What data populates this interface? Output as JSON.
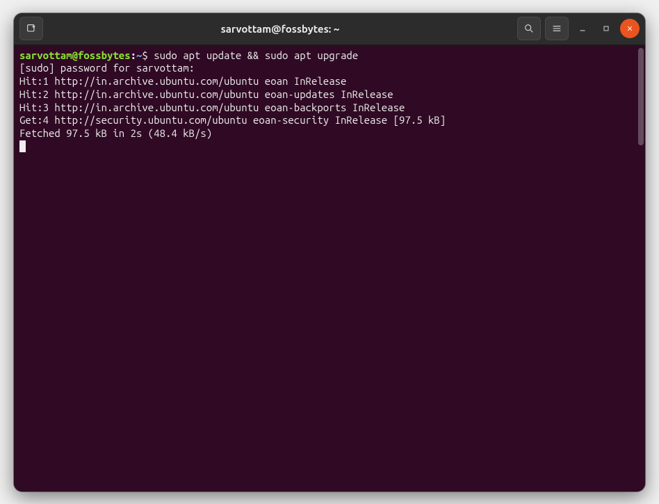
{
  "titlebar": {
    "title": "sarvottam@fossbytes: ~",
    "icons": {
      "new_tab": "new-tab-icon",
      "search": "search-icon",
      "menu": "menu-icon",
      "minimize": "minimize-icon",
      "maximize": "maximize-icon",
      "close": "close-icon"
    }
  },
  "terminal": {
    "prompt": {
      "user_host": "sarvottam@fossbytes",
      "separator": ":",
      "path": "~",
      "symbol": "$"
    },
    "command": " sudo apt update && sudo apt upgrade",
    "output": [
      "[sudo] password for sarvottam:",
      "Hit:1 http://in.archive.ubuntu.com/ubuntu eoan InRelease",
      "Hit:2 http://in.archive.ubuntu.com/ubuntu eoan-updates InRelease",
      "Hit:3 http://in.archive.ubuntu.com/ubuntu eoan-backports InRelease",
      "Get:4 http://security.ubuntu.com/ubuntu eoan-security InRelease [97.5 kB]",
      "Fetched 97.5 kB in 2s (48.4 kB/s)"
    ]
  }
}
